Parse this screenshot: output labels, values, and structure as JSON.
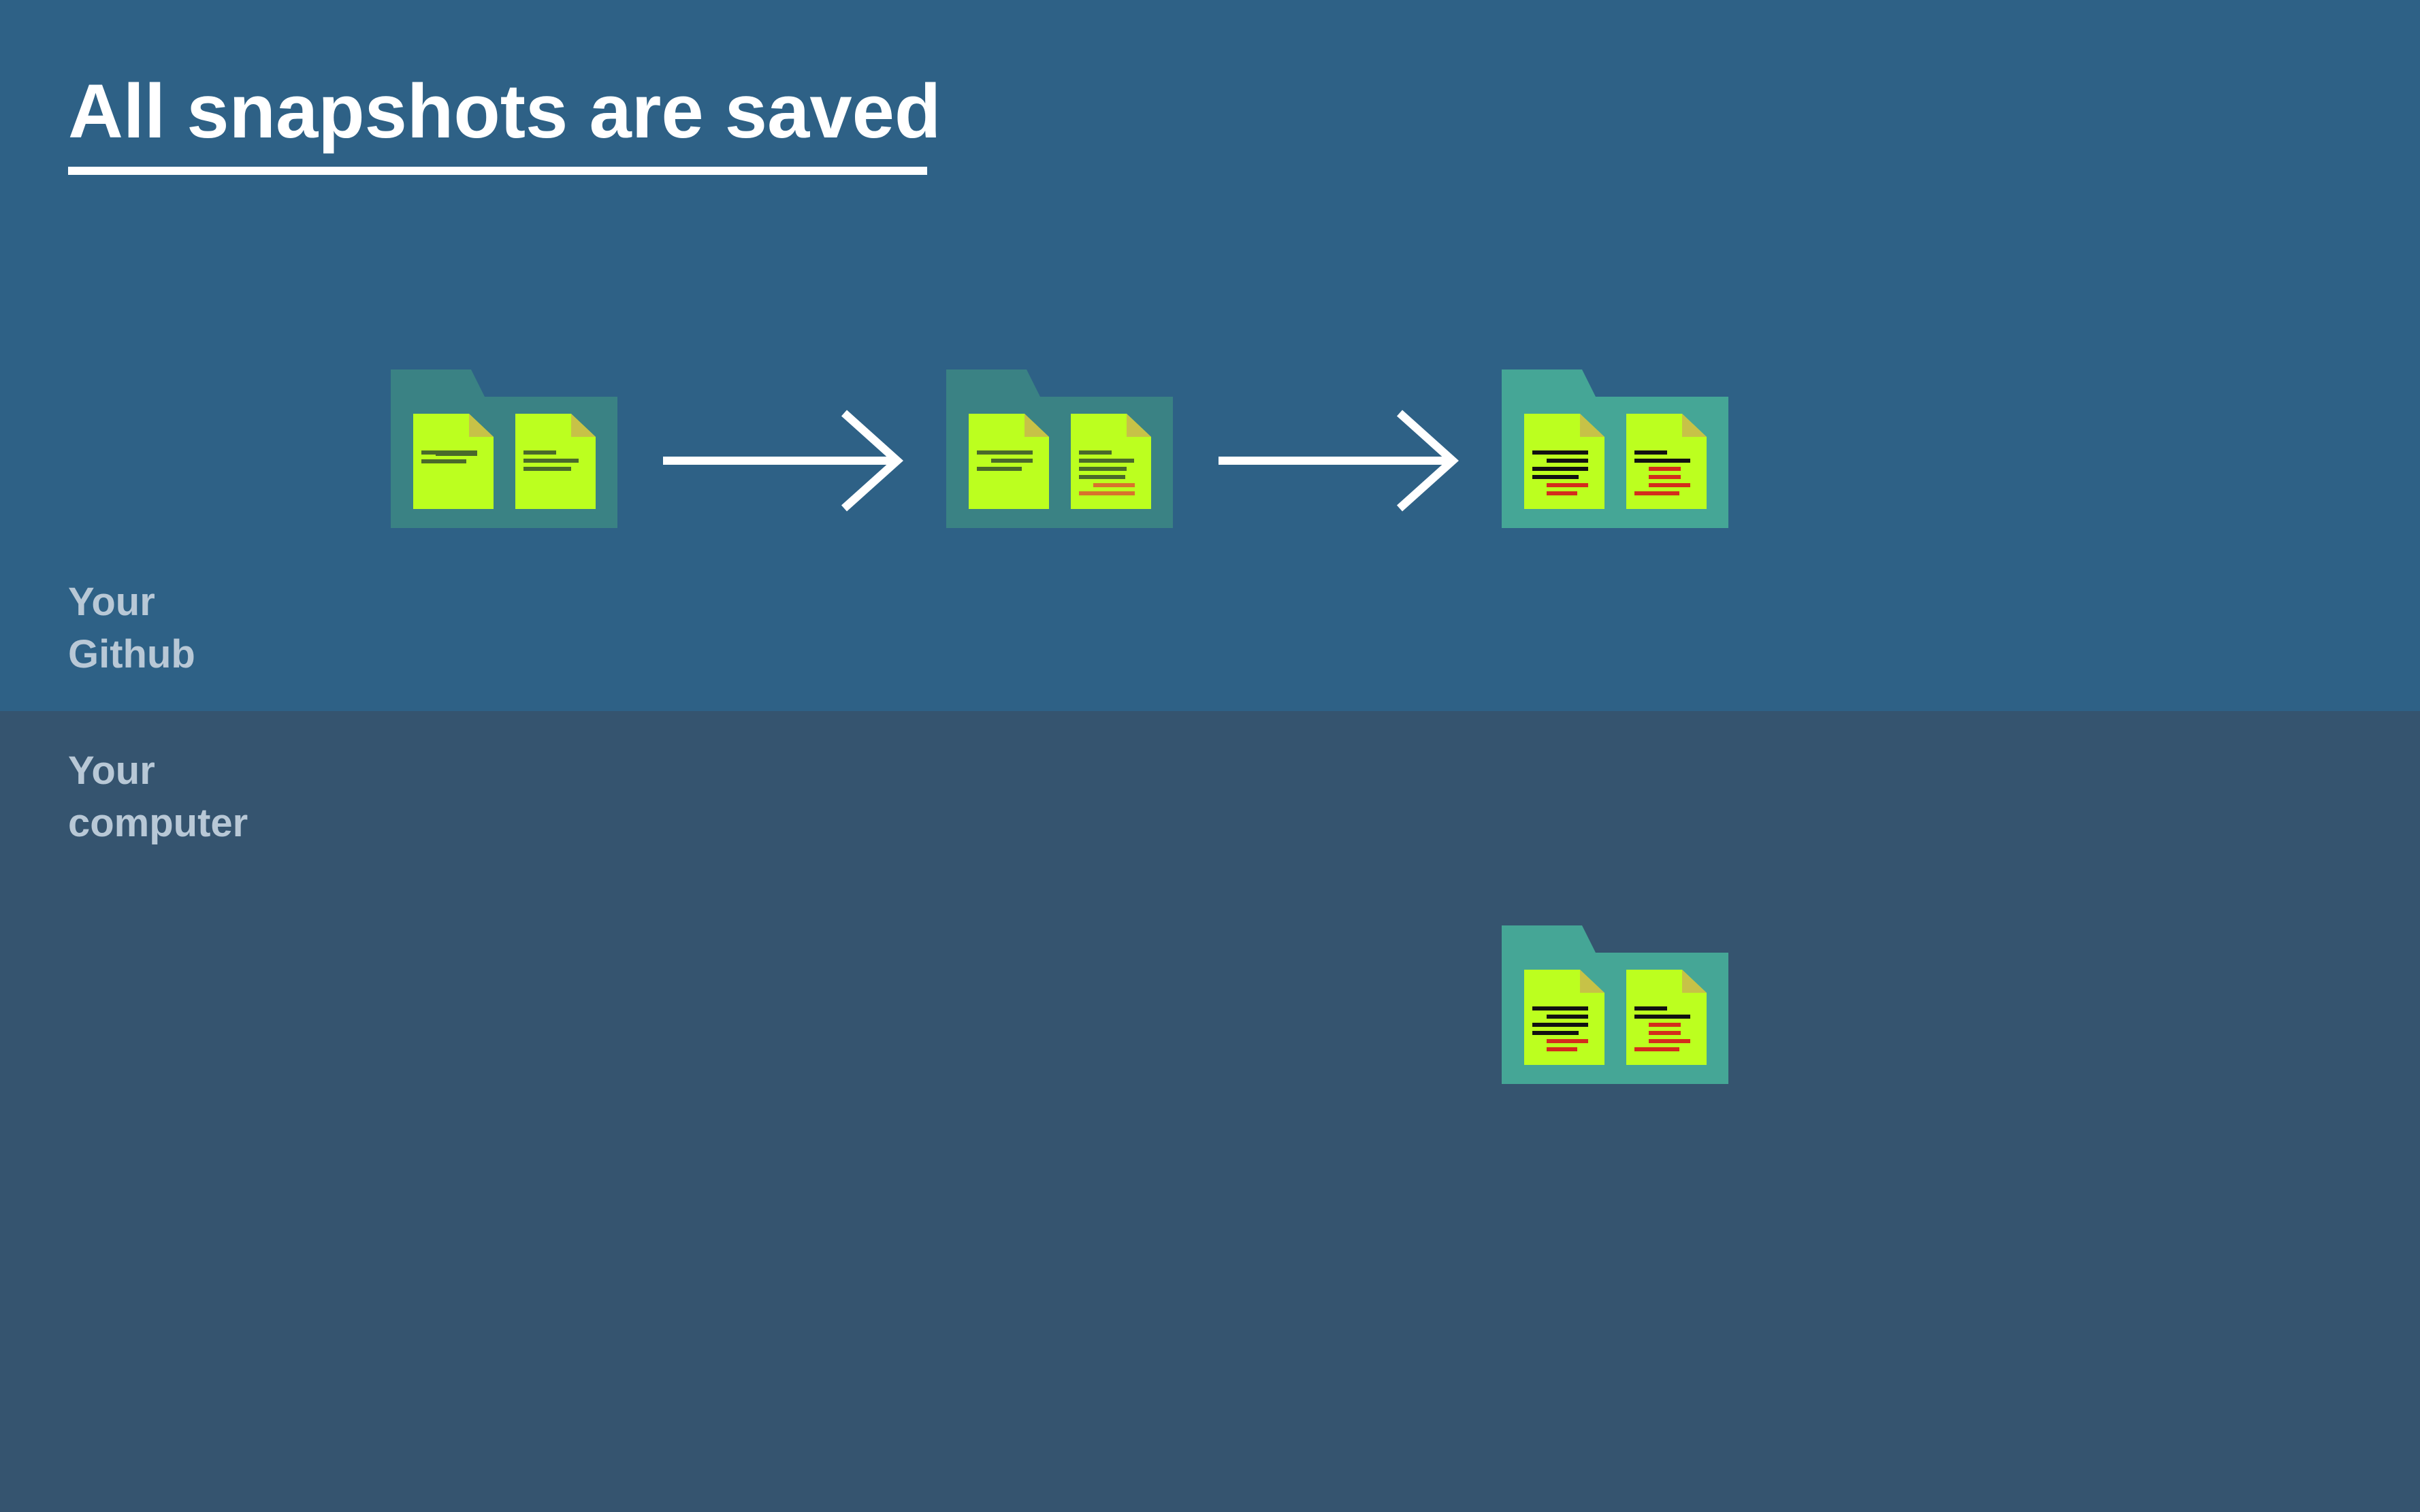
{
  "title": "All snapshots are saved",
  "sections": {
    "remote": {
      "line1": "Your",
      "line2": "Github"
    },
    "local": {
      "line1": "Your",
      "line2": "computer"
    }
  },
  "colors": {
    "remote_bg": "#2e6186",
    "local_bg": "#35546f",
    "doc": "#bcff1f",
    "doc_fold": "#c7c247",
    "arrow": "#ffffff",
    "text_line_old": "#4a6a2a",
    "text_line_new": "#111111",
    "text_line_changed_old": "#d8732c",
    "text_line_changed_new": "#d42d1c"
  },
  "snapshots": [
    {
      "name": "snapshot-1",
      "row": "remote",
      "folder_color": "#3a8284",
      "state": "initial"
    },
    {
      "name": "snapshot-2",
      "row": "remote",
      "folder_color": "#3a8284",
      "state": "edited"
    },
    {
      "name": "snapshot-3",
      "row": "remote",
      "folder_color": "#45a696",
      "state": "latest"
    },
    {
      "name": "local-copy",
      "row": "local",
      "folder_color": "#45a696",
      "state": "latest"
    }
  ],
  "arrows": [
    {
      "from": "snapshot-1",
      "to": "snapshot-2"
    },
    {
      "from": "snapshot-2",
      "to": "snapshot-3"
    }
  ]
}
